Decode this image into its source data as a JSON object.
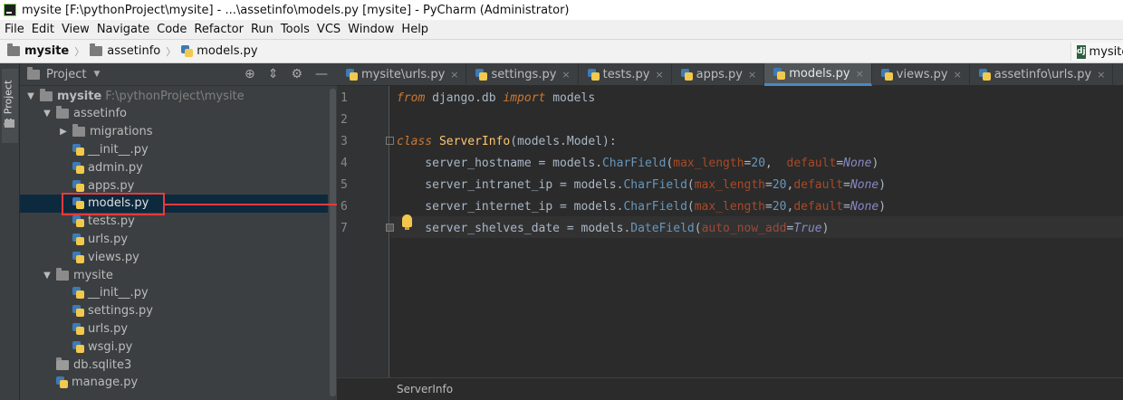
{
  "window": {
    "title": "mysite [F:\\pythonProject\\mysite] - ...\\assetinfo\\models.py [mysite] - PyCharm (Administrator)"
  },
  "menu": [
    "File",
    "Edit",
    "View",
    "Navigate",
    "Code",
    "Refactor",
    "Run",
    "Tools",
    "VCS",
    "Window",
    "Help"
  ],
  "nav": {
    "crumbs": [
      "mysite",
      "assetinfo",
      "models.py"
    ],
    "right_label": "mysite"
  },
  "left_strip": {
    "label": "1: Project"
  },
  "project": {
    "header": "Project",
    "tree": [
      {
        "label": "mysite",
        "path": "F:\\pythonProject\\mysite",
        "depth": 0,
        "expanded": true,
        "kind": "folder",
        "bold": true
      },
      {
        "label": "assetinfo",
        "depth": 1,
        "expanded": true,
        "kind": "folder"
      },
      {
        "label": "migrations",
        "depth": 2,
        "expanded": false,
        "kind": "folder"
      },
      {
        "label": "__init__.py",
        "depth": 2,
        "kind": "py"
      },
      {
        "label": "admin.py",
        "depth": 2,
        "kind": "py"
      },
      {
        "label": "apps.py",
        "depth": 2,
        "kind": "py"
      },
      {
        "label": "models.py",
        "depth": 2,
        "kind": "py",
        "selected": true
      },
      {
        "label": "tests.py",
        "depth": 2,
        "kind": "py"
      },
      {
        "label": "urls.py",
        "depth": 2,
        "kind": "py"
      },
      {
        "label": "views.py",
        "depth": 2,
        "kind": "py"
      },
      {
        "label": "mysite",
        "depth": 1,
        "expanded": true,
        "kind": "folder"
      },
      {
        "label": "__init__.py",
        "depth": 2,
        "kind": "py"
      },
      {
        "label": "settings.py",
        "depth": 2,
        "kind": "py"
      },
      {
        "label": "urls.py",
        "depth": 2,
        "kind": "py"
      },
      {
        "label": "wsgi.py",
        "depth": 2,
        "kind": "py"
      },
      {
        "label": "db.sqlite3",
        "depth": 1,
        "kind": "db"
      },
      {
        "label": "manage.py",
        "depth": 1,
        "kind": "py"
      }
    ]
  },
  "tabs": [
    {
      "label": "mysite\\urls.py",
      "active": false
    },
    {
      "label": "settings.py",
      "active": false
    },
    {
      "label": "tests.py",
      "active": false
    },
    {
      "label": "apps.py",
      "active": false
    },
    {
      "label": "models.py",
      "active": true
    },
    {
      "label": "views.py",
      "active": false
    },
    {
      "label": "assetinfo\\urls.py",
      "active": false
    }
  ],
  "editor": {
    "line_numbers": [
      "1",
      "2",
      "3",
      "4",
      "5",
      "6",
      "7"
    ],
    "lines": [
      [
        {
          "t": "from",
          "c": "kw"
        },
        {
          "t": " django.db ",
          "c": ""
        },
        {
          "t": "import",
          "c": "kw"
        },
        {
          "t": " models",
          "c": ""
        }
      ],
      [],
      [
        {
          "t": "class",
          "c": "kw"
        },
        {
          "t": " ",
          "c": ""
        },
        {
          "t": "ServerInfo",
          "c": "cls"
        },
        {
          "t": "(models.Model):",
          "c": ""
        }
      ],
      [
        {
          "t": "    server_hostname = models.",
          "c": ""
        },
        {
          "t": "CharField",
          "c": "fn"
        },
        {
          "t": "(",
          "c": ""
        },
        {
          "t": "max_length",
          "c": "param"
        },
        {
          "t": "=",
          "c": ""
        },
        {
          "t": "20",
          "c": "num"
        },
        {
          "t": ",  ",
          "c": ""
        },
        {
          "t": "default",
          "c": "param"
        },
        {
          "t": "=",
          "c": ""
        },
        {
          "t": "None",
          "c": "none"
        },
        {
          "t": ")",
          "c": ""
        }
      ],
      [
        {
          "t": "    server_intranet_ip = models.",
          "c": ""
        },
        {
          "t": "CharField",
          "c": "fn"
        },
        {
          "t": "(",
          "c": ""
        },
        {
          "t": "max_length",
          "c": "param"
        },
        {
          "t": "=",
          "c": ""
        },
        {
          "t": "20",
          "c": "num"
        },
        {
          "t": ",",
          "c": ""
        },
        {
          "t": "default",
          "c": "param"
        },
        {
          "t": "=",
          "c": ""
        },
        {
          "t": "None",
          "c": "none"
        },
        {
          "t": ")",
          "c": ""
        }
      ],
      [
        {
          "t": "    server_internet_ip = models.",
          "c": ""
        },
        {
          "t": "CharField",
          "c": "fn"
        },
        {
          "t": "(",
          "c": ""
        },
        {
          "t": "max_length",
          "c": "param"
        },
        {
          "t": "=",
          "c": ""
        },
        {
          "t": "20",
          "c": "num"
        },
        {
          "t": ",",
          "c": ""
        },
        {
          "t": "default",
          "c": "param"
        },
        {
          "t": "=",
          "c": ""
        },
        {
          "t": "None",
          "c": "none"
        },
        {
          "t": ")",
          "c": ""
        }
      ],
      [
        {
          "t": "    server_shelves_date = models.",
          "c": ""
        },
        {
          "t": "DateField",
          "c": "fn"
        },
        {
          "t": "(",
          "c": ""
        },
        {
          "t": "auto_now_add",
          "c": "dim"
        },
        {
          "t": "=",
          "c": ""
        },
        {
          "t": "True",
          "c": "none"
        },
        {
          "t": ")",
          "c": ""
        }
      ]
    ],
    "status_breadcrumb": "ServerInfo"
  }
}
